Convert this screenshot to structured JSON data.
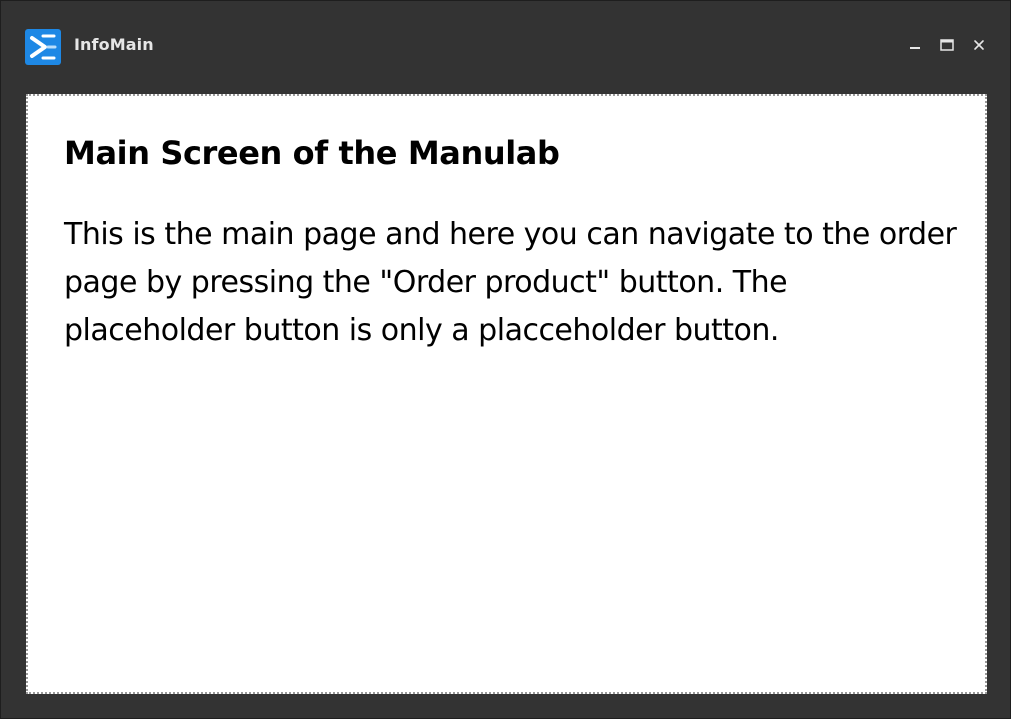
{
  "window": {
    "title": "InfoMain",
    "icon": "app-logo-icon",
    "controls": {
      "minimize_icon": "minimize-icon",
      "maximize_icon": "maximize-icon",
      "close_icon": "close-icon"
    }
  },
  "main": {
    "heading": "Main Screen of the Manulab",
    "description": "This is the main page and here you can navigate to the order page by pressing the \"Order product\" button. The placeholder button is only a placceholder button."
  },
  "colors": {
    "chrome": "#333333",
    "panel": "#ffffff",
    "accent": "#1e88e5",
    "title_text": "#e6e6e6"
  }
}
